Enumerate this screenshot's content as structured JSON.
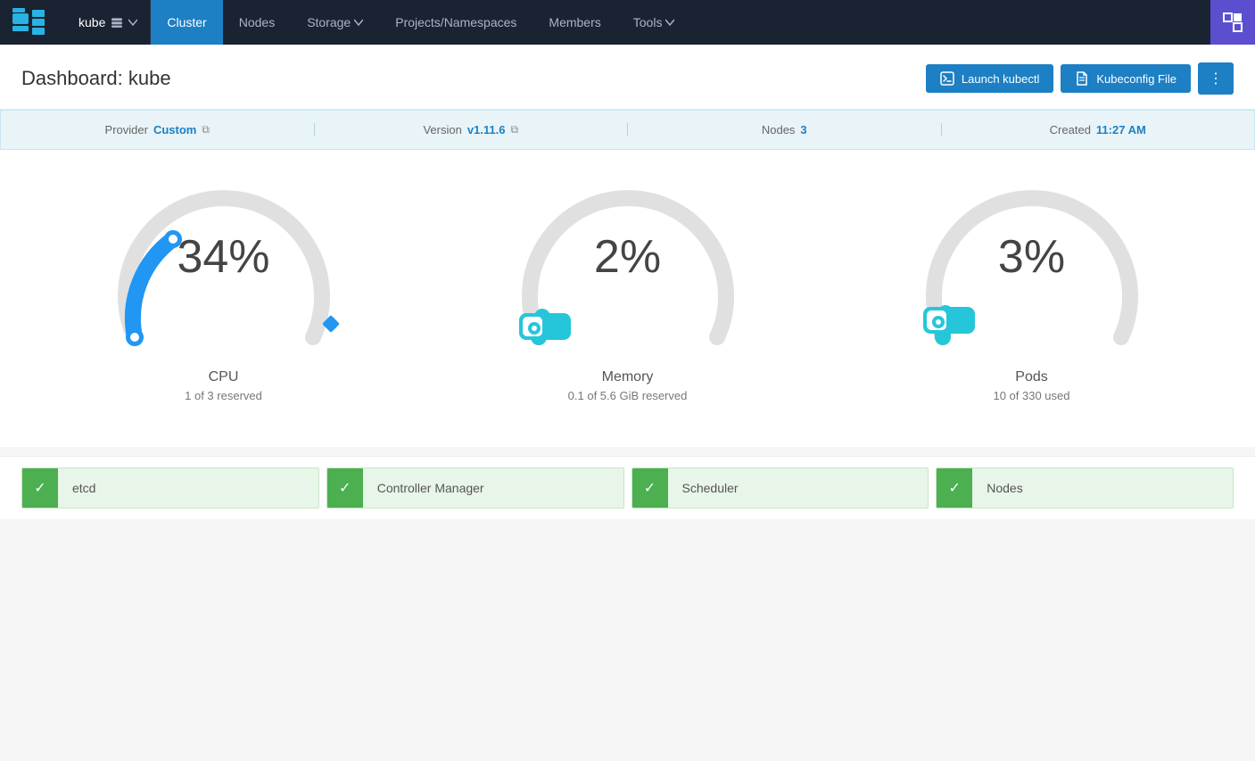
{
  "nav": {
    "logo_alt": "Rancher",
    "kube_name": "kube",
    "items": [
      {
        "id": "cluster",
        "label": "Cluster",
        "active": true,
        "hasArrow": false
      },
      {
        "id": "nodes",
        "label": "Nodes",
        "active": false,
        "hasArrow": false
      },
      {
        "id": "storage",
        "label": "Storage",
        "active": false,
        "hasArrow": true
      },
      {
        "id": "projects",
        "label": "Projects/Namespaces",
        "active": false,
        "hasArrow": false
      },
      {
        "id": "members",
        "label": "Members",
        "active": false,
        "hasArrow": false
      },
      {
        "id": "tools",
        "label": "Tools",
        "active": false,
        "hasArrow": true
      }
    ]
  },
  "header": {
    "title": "Dashboard: kube",
    "btn_kubectl": "Launch kubectl",
    "btn_kubeconfig": "Kubeconfig File",
    "btn_dots": "⋮"
  },
  "info_bar": {
    "provider_label": "Provider",
    "provider_value": "Custom",
    "version_label": "Version",
    "version_value": "v1.11.6",
    "nodes_label": "Nodes",
    "nodes_value": "3",
    "created_label": "Created",
    "created_value": "11:27 AM"
  },
  "gauges": [
    {
      "id": "cpu",
      "percent": "34%",
      "label": "CPU",
      "sublabel": "1 of 3 reserved",
      "value": 34,
      "color": "#2196f3",
      "type": "arc"
    },
    {
      "id": "memory",
      "percent": "2%",
      "label": "Memory",
      "sublabel": "0.1 of 5.6 GiB reserved",
      "value": 2,
      "color": "#26c6da",
      "type": "arc"
    },
    {
      "id": "pods",
      "percent": "3%",
      "label": "Pods",
      "sublabel": "10 of 330 used",
      "value": 3,
      "color": "#26c6da",
      "type": "arc"
    }
  ],
  "status_items": [
    {
      "id": "etcd",
      "label": "etcd",
      "ok": true
    },
    {
      "id": "controller-manager",
      "label": "Controller Manager",
      "ok": true
    },
    {
      "id": "scheduler",
      "label": "Scheduler",
      "ok": true
    },
    {
      "id": "nodes",
      "label": "Nodes",
      "ok": true
    }
  ]
}
